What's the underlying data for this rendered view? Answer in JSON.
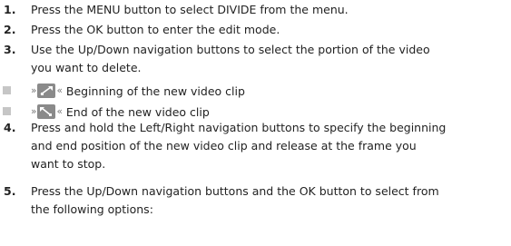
{
  "steps": [
    {
      "marker": "1.",
      "lines": [
        "Press the MENU button to select DIVIDE from the menu."
      ]
    },
    {
      "marker": "2.",
      "lines": [
        "Press the OK button to enter the edit mode."
      ]
    },
    {
      "marker": "3.",
      "lines": [
        "Use the Up/Down navigation buttons to select the portion of the video",
        "you want to delete."
      ]
    },
    {
      "marker": "4.",
      "lines": [
        "Press and hold the Left/Right navigation buttons to specify the beginning",
        "and end position of the new video clip and release at the frame you",
        "want to stop."
      ]
    },
    {
      "marker": "5.",
      "lines": [
        "Press the Up/Down navigation buttons and the OK button to select from",
        "the following options:"
      ]
    }
  ],
  "bullets": [
    {
      "open": "»",
      "icon": "clip-start-icon",
      "close": "«",
      "label": "Beginning of the new video clip"
    },
    {
      "open": "»",
      "icon": "clip-end-icon",
      "close": "«",
      "label": "End of the new video clip"
    }
  ],
  "colors": {
    "text": "#222222",
    "bullet": "#c6c6c6",
    "icon_bg": "#8a8a8a"
  }
}
